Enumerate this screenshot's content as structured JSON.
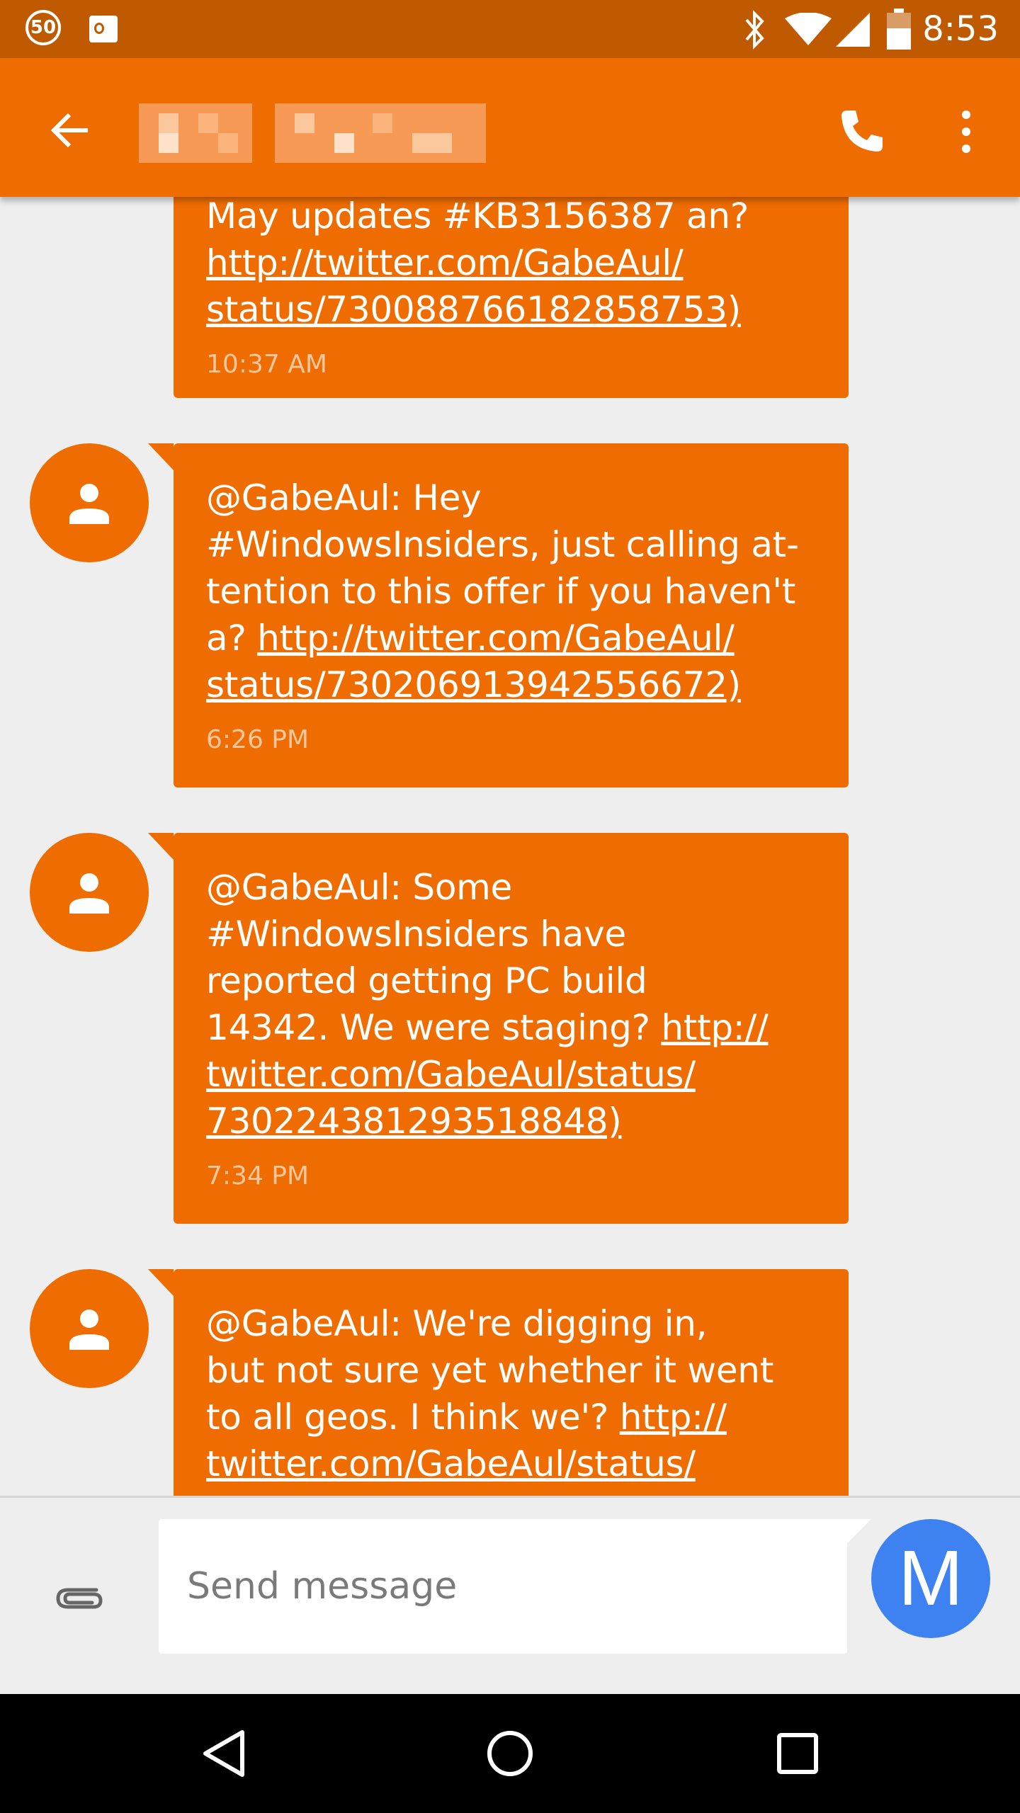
{
  "status_bar": {
    "badge_count": "50",
    "time": "8:53",
    "icons": [
      "outlook-icon",
      "bluetooth-icon",
      "wifi-icon",
      "signal-icon",
      "battery-icon"
    ]
  },
  "app_bar": {
    "accent_color": "#ef6c00",
    "icons": [
      "back-arrow-icon",
      "phone-icon",
      "more-vert-icon"
    ]
  },
  "messages": [
    {
      "text_lines": "May updates #KB3156387 an? ",
      "link": "http://twitter.com/GabeAul/\nstatus/730088766182858753)",
      "time": "10:37 AM"
    },
    {
      "text_lines": "@GabeAul: Hey\n#WindowsInsiders, just calling at-\ntention to this offer if you haven't\na? ",
      "link": "http://twitter.com/GabeAul/\nstatus/730206913942556672)",
      "time": "6:26 PM"
    },
    {
      "text_lines": "@GabeAul: Some\n#WindowsInsiders have\nreported getting PC build\n14342. We were staging? ",
      "link": "http://\ntwitter.com/GabeAul/status/\n730224381293518848)",
      "time": "7:34 PM"
    },
    {
      "text_lines": "@GabeAul: We're digging in,\nbut not sure yet whether it went\nto all geos. I think we'? ",
      "link": "http://\ntwitter.com/GabeAul/status/",
      "time": ""
    }
  ],
  "compose": {
    "placeholder": "Send message",
    "self_avatar_letter": "M",
    "self_avatar_color": "#3d82f0"
  },
  "nav_bar": {
    "icons": [
      "nav-back-icon",
      "nav-home-icon",
      "nav-recents-icon"
    ]
  }
}
